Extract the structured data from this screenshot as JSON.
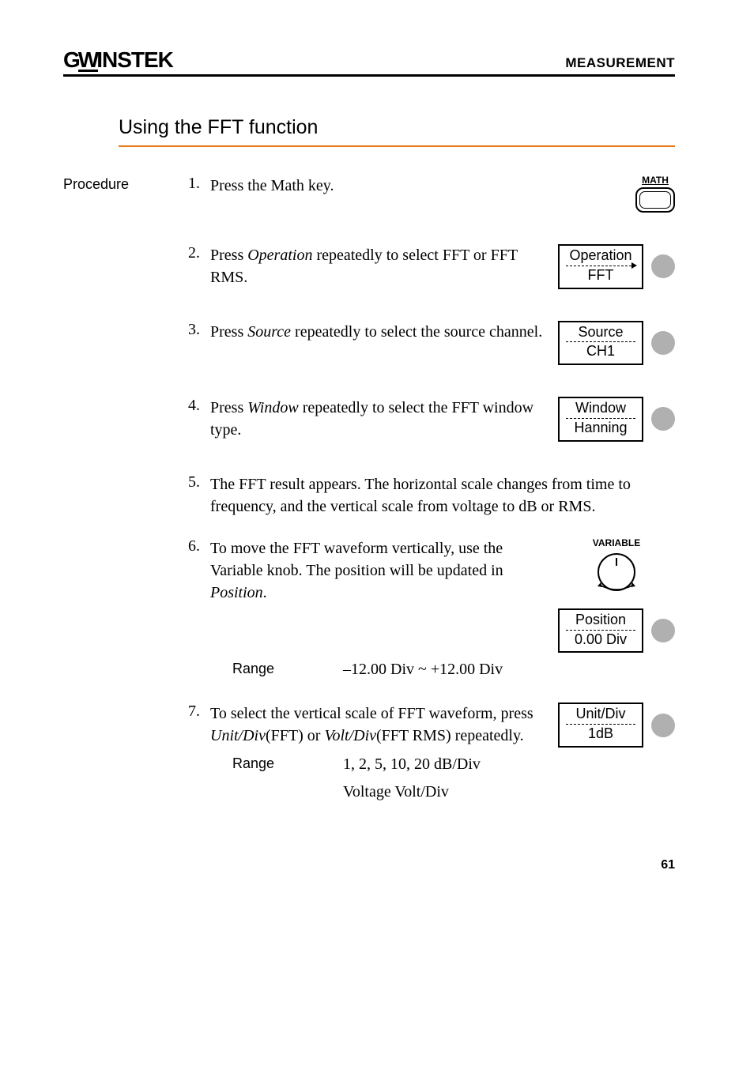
{
  "header": {
    "brand_g": "G",
    "brand_u": "W",
    "brand_rest": "INSTEK",
    "right": "MEASUREMENT"
  },
  "section_title": "Using the FFT function",
  "left_label": "Procedure",
  "steps": {
    "s1": {
      "num": "1.",
      "text": "Press the Math key.",
      "math_label": "MATH"
    },
    "s2": {
      "num": "2.",
      "pre": "Press ",
      "italic": "Operation",
      "post": " repeatedly to select FFT or FFT RMS.",
      "key_top": "Operation",
      "key_bottom": "FFT"
    },
    "s3": {
      "num": "3.",
      "pre": "Press ",
      "italic": "Source",
      "post": " repeatedly to select the source channel.",
      "key_top": "Source",
      "key_bottom": "CH1"
    },
    "s4": {
      "num": "4.",
      "pre": "Press ",
      "italic": "Window",
      "post": " repeatedly to select the FFT window type.",
      "key_top": "Window",
      "key_bottom": "Hanning"
    },
    "s5": {
      "num": "5.",
      "text": "The FFT result appears. The horizontal scale changes from time to frequency, and the vertical scale from voltage to dB or RMS."
    },
    "s6": {
      "num": "6.",
      "pre": "To move the FFT waveform vertically, use the Variable knob. The position will be updated in ",
      "italic": "Position",
      "post": ".",
      "var_label": "VARIABLE",
      "key_top": "Position",
      "key_bottom": "0.00 Div",
      "range_label": "Range",
      "range_value": "–12.00 Div ~ +12.00 Div"
    },
    "s7": {
      "num": "7.",
      "pre": "To select the vertical scale of FFT waveform, press ",
      "italic1": "Unit/Div",
      "mid1": "(FFT) or ",
      "italic2": "Volt/Div",
      "mid2": "(FFT RMS) repeatedly.",
      "key_top": "Unit/Div",
      "key_bottom": "1dB",
      "range_label": "Range",
      "range_value1": "1, 2, 5, 10, 20 dB/Div",
      "range_value2": "Voltage Volt/Div"
    }
  },
  "page_number": "61"
}
